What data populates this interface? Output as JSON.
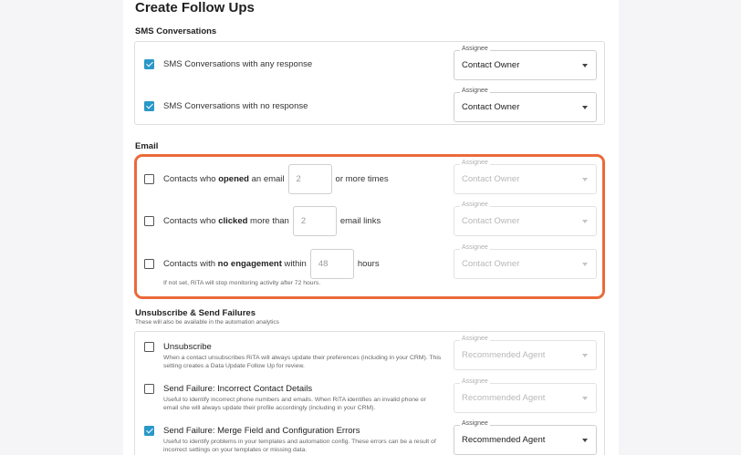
{
  "page": {
    "title": "Create Follow Ups"
  },
  "sms": {
    "heading": "SMS Conversations",
    "rows": [
      {
        "checked": true,
        "label": "SMS Conversations with any response",
        "assignee_label": "Assignee",
        "assignee_value": "Contact Owner"
      },
      {
        "checked": true,
        "label": "SMS Conversations with no response",
        "assignee_label": "Assignee",
        "assignee_value": "Contact Owner"
      }
    ]
  },
  "email": {
    "heading": "Email",
    "opened": {
      "checked": false,
      "pre": "Contacts who ",
      "strong": "opened",
      "mid": " an email",
      "value": "2",
      "post": "or more times",
      "assignee_label": "Assignee",
      "assignee_value": "Contact Owner"
    },
    "clicked": {
      "checked": false,
      "pre": "Contacts who ",
      "strong": "clicked",
      "mid": " more than",
      "value": "2",
      "post": "email links",
      "assignee_label": "Assignee",
      "assignee_value": "Contact Owner"
    },
    "no_engagement": {
      "checked": false,
      "pre": "Contacts with ",
      "strong": "no engagement",
      "mid": " within",
      "value": "48",
      "post": "hours",
      "assignee_label": "Assignee",
      "assignee_value": "Contact Owner"
    },
    "note": "If not set, RiTA will stop monitoring activity after 72 hours."
  },
  "unsubscribe": {
    "heading": "Unsubscribe & Send Failures",
    "hint": "These will also be available in the automation analytics",
    "rows": [
      {
        "checked": false,
        "label": "Unsubscribe",
        "desc": "When a contact unsubscribes RiTA will always update their preferences (including in your CRM). This setting creates a Data Update Follow Up for review.",
        "assignee_label": "Assignee",
        "assignee_value": "Recommended Agent"
      },
      {
        "checked": false,
        "label": "Send Failure: Incorrect Contact Details",
        "desc": "Useful to identify incorrect phone numbers and emails. When RiTA identifies an invalid phone or email she will always update their profile accordingly (including in your CRM).",
        "assignee_label": "Assignee",
        "assignee_value": "Recommended Agent"
      },
      {
        "checked": true,
        "label": "Send Failure: Merge Field and Configuration Errors",
        "desc": "Useful to identify problems in your templates and automation config. These errors can be a result of incorrect settings on your templates or missing data.",
        "assignee_label": "Assignee",
        "assignee_value": "Recommended Agent"
      }
    ]
  },
  "colors": {
    "accent": "#2a98c8",
    "highlight": "#ea6a3a"
  }
}
